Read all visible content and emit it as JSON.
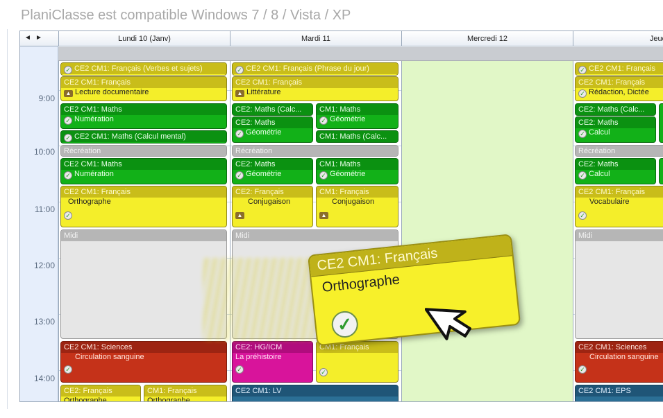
{
  "headline": "PlaniClasse est compatible Windows 7 / 8 / Vista / XP",
  "nav": {
    "prev": "◄",
    "next": "►"
  },
  "days": [
    "Lundi 10 (Janv)",
    "Mardi 11",
    "Mercredi 12",
    "Jeudi"
  ],
  "times": [
    "9:00",
    "10:00",
    "11:00",
    "12:00",
    "13:00",
    "14:00"
  ],
  "icons": {
    "check": "✓",
    "book": "▲"
  },
  "events": {
    "mon": [
      {
        "title": "CE2 CM1: Français (Verbes et sujets)"
      },
      {
        "title": "CE2 CM1: Français",
        "sub": "Lecture documentaire"
      },
      {
        "title": "CE2 CM1: Maths",
        "sub": "Numération"
      },
      {
        "title": "CE2 CM1: Maths (Calcul mental)"
      },
      {
        "title": "Récréation"
      },
      {
        "title": "CE2 CM1: Maths",
        "sub": "Numération"
      },
      {
        "title": "CE2 CM1: Français",
        "sub": "Orthographe"
      },
      {
        "title": "Midi"
      },
      {
        "title": "CE2 CM1: Sciences",
        "sub": "Circulation sanguine"
      },
      {
        "title": "CE2: Français",
        "sub": "Orthographe"
      },
      {
        "title": "CM1: Français",
        "sub": "Orthographe"
      }
    ],
    "tue": [
      {
        "title": "CE2 CM1: Français (Phrase du jour)"
      },
      {
        "title": "CE2 CM1: Français",
        "sub": "Littérature"
      },
      {
        "title": "CE2: Maths (Calc...",
        "sub": ""
      },
      {
        "title": "CE2: Maths",
        "sub": "Géométrie"
      },
      {
        "title": "CM1: Maths",
        "sub": "Géométrie"
      },
      {
        "title": "CM1: Maths (Calc..."
      },
      {
        "title": "Récréation"
      },
      {
        "title": "CE2: Maths",
        "sub": "Géométrie"
      },
      {
        "title": "CM1: Maths",
        "sub": "Géométrie"
      },
      {
        "title": "CE2: Français",
        "sub": "Conjugaison"
      },
      {
        "title": "CM1: Français",
        "sub": "Conjugaison"
      },
      {
        "title": "Midi"
      },
      {
        "title": "CE2: HG/ICM",
        "sub": "La préhistoire"
      },
      {
        "title": "CM1: Français"
      },
      {
        "title": "CE2 CM1: LV"
      }
    ],
    "thu": [
      {
        "title": "CE2 CM1: Français"
      },
      {
        "title": "CE2 CM1: Français",
        "sub": "Rédaction, Dictée"
      },
      {
        "title": "CE2: Maths (Calc..."
      },
      {
        "title": "CE2: Maths",
        "sub": "Calcul"
      },
      {
        "title": "Récréation"
      },
      {
        "title": "CE2: Maths",
        "sub": "Calcul"
      },
      {
        "title": "CE2 CM1: Français",
        "sub": "Vocabulaire"
      },
      {
        "title": "Midi"
      },
      {
        "title": "CE2 CM1: Sciences",
        "sub": "Circulation sanguine"
      },
      {
        "title": "CE2 CM1: EPS"
      }
    ]
  },
  "drag": {
    "title": "CE2 CM1: Français",
    "subject": "Orthographe"
  },
  "colors": {
    "green": "#12b118",
    "yellow": "#f4ee2a",
    "red": "#c53219",
    "magenta": "#d8149b",
    "wednesday": "#e1f7c7"
  }
}
